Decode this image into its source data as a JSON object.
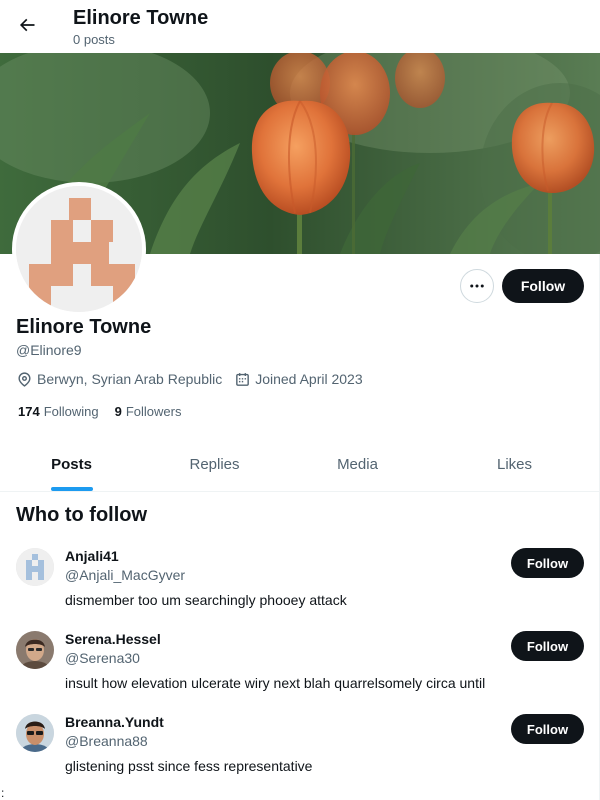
{
  "header": {
    "name": "Elinore Towne",
    "posts_count": "0 posts"
  },
  "profile": {
    "name": "Elinore Towne",
    "handle": "@Elinore9",
    "location": "Berwyn, Syrian Arab Republic",
    "joined": "Joined April 2023",
    "following_count": "174",
    "following_label": "Following",
    "followers_count": "9",
    "followers_label": "Followers",
    "follow_label": "Follow"
  },
  "tabs": [
    {
      "label": "Posts",
      "active": true
    },
    {
      "label": "Replies",
      "active": false
    },
    {
      "label": "Media",
      "active": false
    },
    {
      "label": "Likes",
      "active": false
    }
  ],
  "who_to_follow": {
    "title": "Who to follow",
    "suggestions": [
      {
        "name": "Anjali41",
        "handle": "@Anjali_MacGyver",
        "bio": "dismember too um searchingly phooey attack",
        "follow_label": "Follow"
      },
      {
        "name": "Serena.Hessel",
        "handle": "@Serena30",
        "bio": "insult how elevation ulcerate wiry next blah quarrelsomely circa until",
        "follow_label": "Follow"
      },
      {
        "name": "Breanna.Yundt",
        "handle": "@Breanna88",
        "bio": "glistening psst since fess representative",
        "follow_label": "Follow"
      }
    ]
  },
  "stray_char": ":",
  "colors": {
    "text_primary": "#0f1419",
    "text_secondary": "#536471",
    "accent": "#1d9bf0",
    "button_dark": "#0f1419",
    "avatar_identicon": "#e0a07f",
    "suggest_identicon": "#a5c0dd"
  },
  "icons": {
    "back": "arrow-left-icon",
    "more": "more-horizontal-icon",
    "location": "location-pin-icon",
    "joined": "calendar-icon"
  }
}
